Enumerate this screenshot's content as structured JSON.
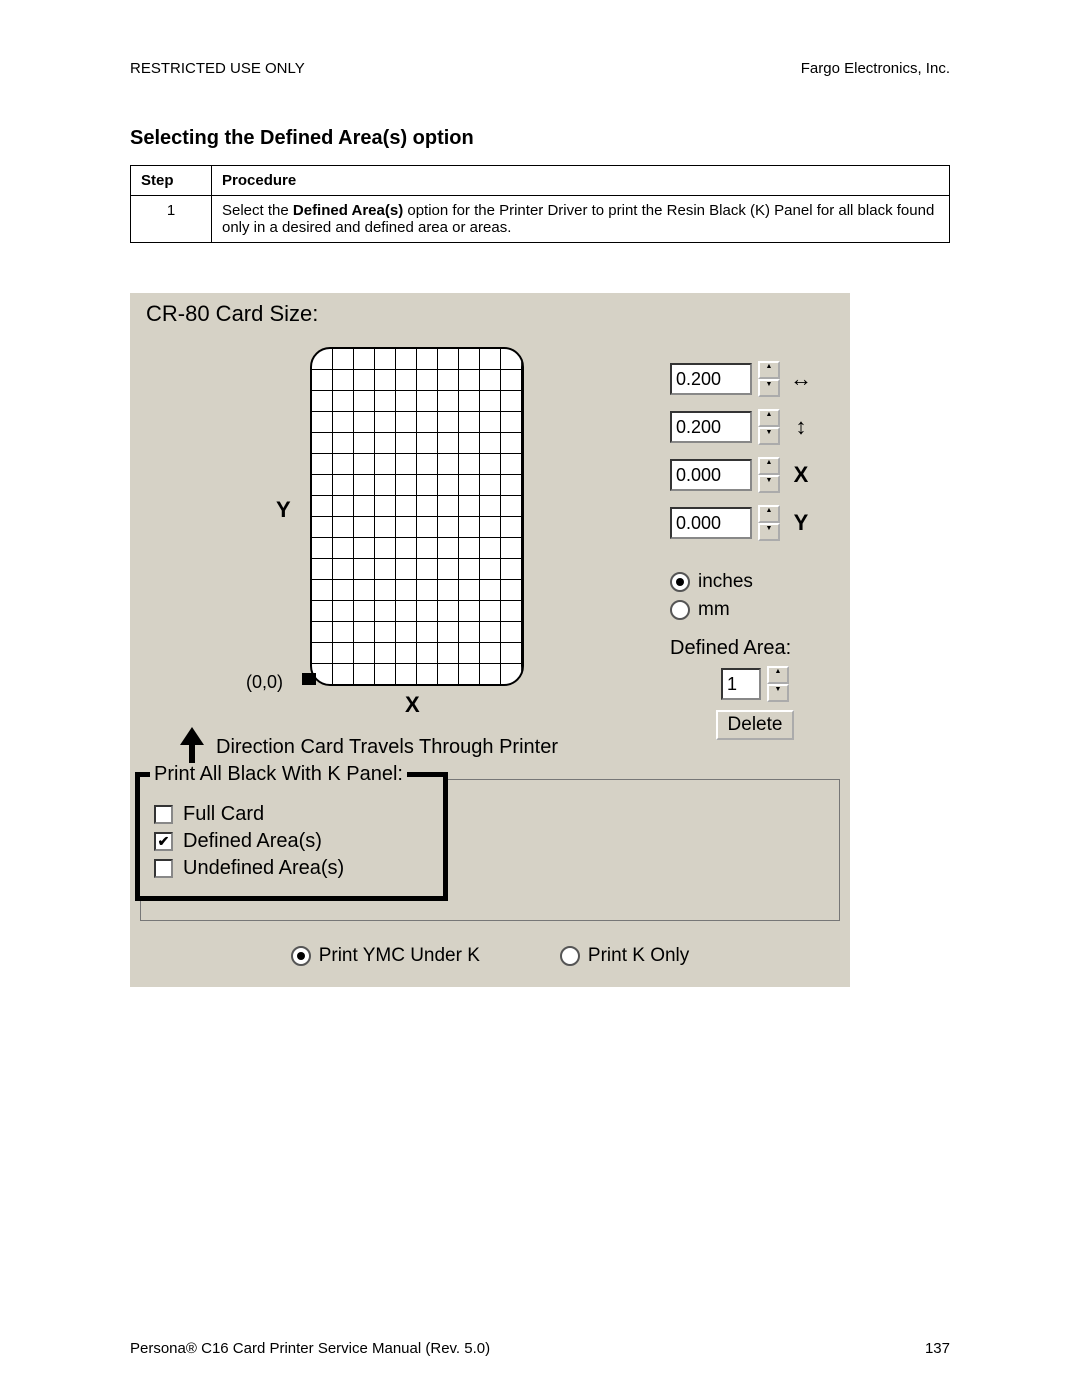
{
  "header": {
    "left": "RESTRICTED USE ONLY",
    "right": "Fargo Electronics, Inc."
  },
  "section_title": "Selecting the Defined Area(s) option",
  "table": {
    "headers": {
      "step": "Step",
      "procedure": "Procedure"
    },
    "rows": [
      {
        "step": "1",
        "text_before": "Select the ",
        "text_bold": "Defined Area(s)",
        "text_after": " option for the Printer Driver to print the Resin Black (K) Panel for all black found only in a desired and defined area or areas."
      }
    ]
  },
  "dialog": {
    "title": "CR-80 Card Size:",
    "y_axis": "Y",
    "x_axis": "X",
    "origin": "(0,0)",
    "direction_text": "Direction Card Travels Through Printer",
    "spinners": {
      "width": {
        "value": "0.200",
        "icon": "↔"
      },
      "height": {
        "value": "0.200",
        "icon": "↕"
      },
      "x": {
        "value": "0.000",
        "icon": "X"
      },
      "y": {
        "value": "0.000",
        "icon": "Y"
      }
    },
    "units": {
      "inches": {
        "label": "inches",
        "checked": true
      },
      "mm": {
        "label": "mm",
        "checked": false
      }
    },
    "defined_area": {
      "label": "Defined Area:",
      "value": "1",
      "delete": "Delete"
    },
    "k_panel": {
      "legend": "Print All Black With K Panel:",
      "full_card": {
        "label": "Full Card",
        "checked": false
      },
      "defined_areas": {
        "label": "Defined Area(s)",
        "checked": true
      },
      "undefined_areas": {
        "label": "Undefined Area(s)",
        "checked": false
      }
    },
    "print_mode": {
      "ymc": {
        "label": "Print YMC Under K",
        "checked": true
      },
      "konly": {
        "label": "Print K Only",
        "checked": false
      }
    }
  },
  "footer": {
    "left_prefix": "Persona",
    "left_reg": "®",
    "left_suffix": " C16 Card Printer Service Manual (Rev. 5.0)",
    "page": "137"
  }
}
